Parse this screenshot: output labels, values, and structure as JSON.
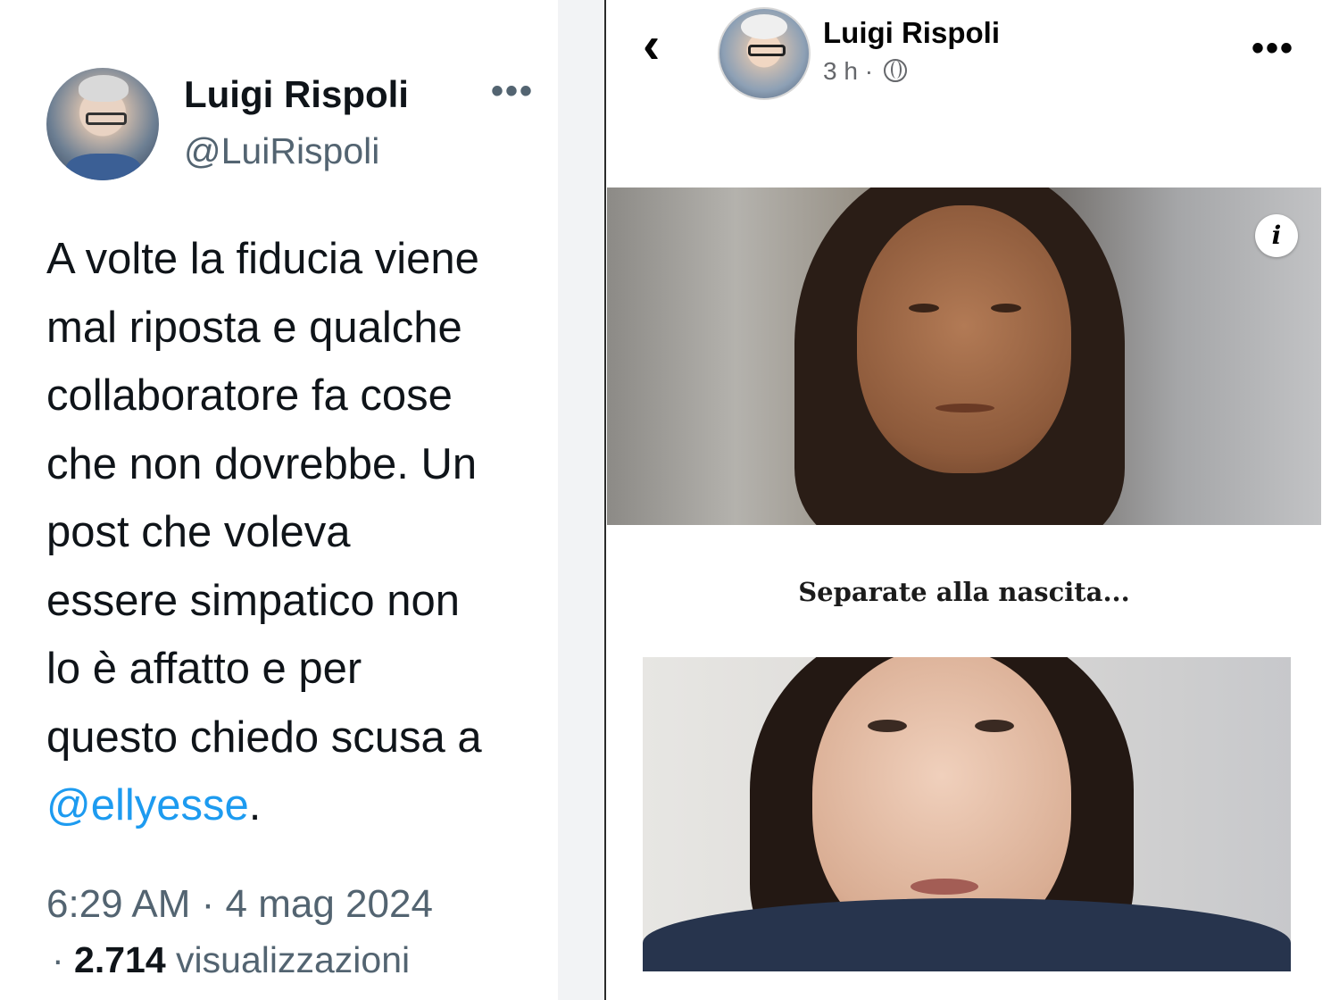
{
  "tweet": {
    "name": "Luigi Rispoli",
    "handle": "@LuiRispoli",
    "more_icon": "more-icon",
    "text_lines": [
      "A volte la fiducia viene",
      "mal riposta e qualche",
      "collaboratore fa cose",
      "che non dovrebbe. Un",
      "post che voleva",
      "essere simpatico non",
      "lo è affatto e per",
      "questo chiedo scusa a"
    ],
    "mention": "@ellyesse",
    "mention_suffix": ".",
    "time": "6:29 AM · 4 mag 2024",
    "views_prefix": "· ",
    "views_count": "2.714",
    "views_label": " visualizzazioni",
    "colors": {
      "mention": "#1d9bf0",
      "secondary": "#536471"
    }
  },
  "fb": {
    "name": "Luigi Rispoli",
    "time": "3 h ·",
    "back_icon": "back-chevron-icon",
    "globe_icon": "globe-icon",
    "more_icon": "more-icon",
    "info_label": "i",
    "caption": "Separate alla nascita..."
  }
}
